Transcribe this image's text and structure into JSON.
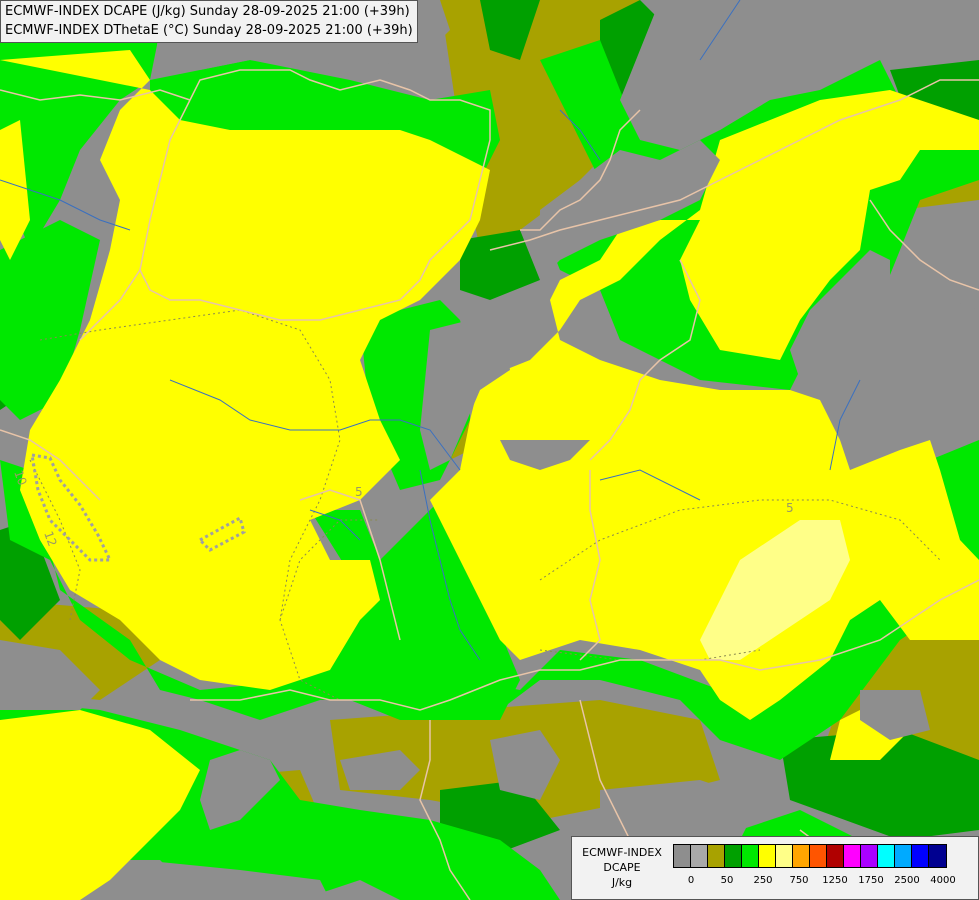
{
  "title_lines": [
    "ECMWF-INDEX DCAPE (J/kg) Sunday 28-09-2025 21:00 (+39h)",
    "ECMWF-INDEX DThetaE (°C) Sunday 28-09-2025 21:00 (+39h)"
  ],
  "legend": {
    "title": [
      "ECMWF-INDEX",
      "DCAPE",
      "J/kg"
    ],
    "colors": [
      "#8e8e8e",
      "#a9a9a9",
      "#a8a200",
      "#00a000",
      "#00e800",
      "#ffff00",
      "#ffff88",
      "#ffa500",
      "#ff5500",
      "#b00000",
      "#ff00ff",
      "#aa00ff",
      "#00ffff",
      "#00aaff",
      "#0000ff",
      "#000090"
    ],
    "tick_labels": [
      "0",
      "50",
      "250",
      "750",
      "1250",
      "1750",
      "2500",
      "4000"
    ]
  },
  "contour_labels": [
    "10",
    "12",
    "5",
    "5"
  ],
  "palette": {
    "gray": "#8e8e8e",
    "olive": "#a8a200",
    "dark_green": "#00a000",
    "green": "#00e800",
    "yellow": "#ffff00",
    "light_yellow": "#ffff88",
    "border": "#e8c4a8",
    "river": "#3a70c0"
  }
}
